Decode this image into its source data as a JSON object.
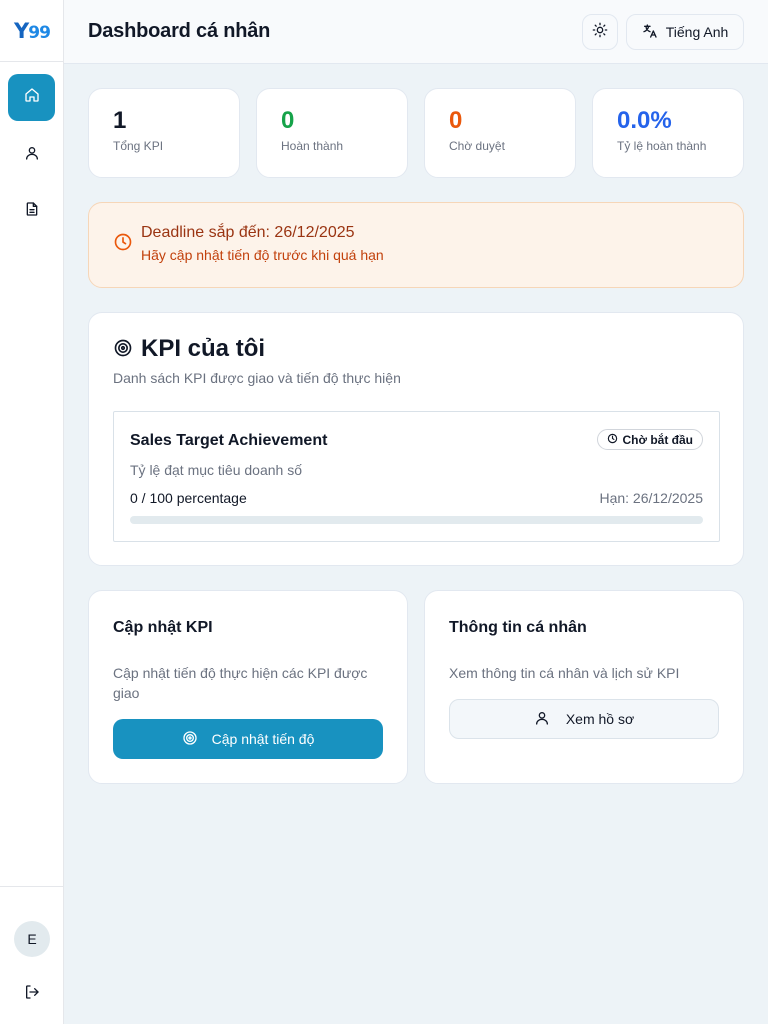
{
  "brand": {
    "logo_text": "Y99",
    "logo_letter": "Y",
    "logo_number": "99"
  },
  "colors": {
    "primary": "#1892c0",
    "green": "#16a34a",
    "orange": "#ea580c",
    "blue": "#2563eb",
    "alert_bg": "#fdf3ea"
  },
  "sidebar": {
    "items": [
      {
        "icon": "home-icon",
        "active": true
      },
      {
        "icon": "user-icon",
        "active": false
      },
      {
        "icon": "document-icon",
        "active": false
      }
    ],
    "avatar_initial": "E",
    "logout_icon": "logout-icon"
  },
  "header": {
    "title": "Dashboard cá nhân",
    "theme_icon": "sun-icon",
    "language_label": "Tiếng Anh",
    "language_icon": "translate-icon"
  },
  "stats": [
    {
      "value": "1",
      "label": "Tổng KPI",
      "color": "#111827"
    },
    {
      "value": "0",
      "label": "Hoàn thành",
      "color": "#16a34a"
    },
    {
      "value": "0",
      "label": "Chờ duyệt",
      "color": "#ea580c"
    },
    {
      "value": "0.0%",
      "label": "Tỷ lệ hoàn thành",
      "color": "#2563eb"
    }
  ],
  "alert": {
    "icon": "clock-icon",
    "title": "Deadline sắp đến: 26/12/2025",
    "subtitle": "Hãy cập nhật tiến độ trước khi quá hạn"
  },
  "kpi_section": {
    "icon": "target-icon",
    "title": "KPI của tôi",
    "description": "Danh sách KPI được giao và tiến độ thực hiện",
    "items": [
      {
        "name": "Sales Target Achievement",
        "status": "Chờ bắt đầu",
        "status_icon": "clock-icon",
        "description": "Tỷ lệ đạt mục tiêu doanh số",
        "progress_text": "0 / 100 percentage",
        "deadline": "Hạn: 26/12/2025",
        "progress_fraction": 0
      }
    ]
  },
  "actions": {
    "update": {
      "title": "Cập nhật KPI",
      "description": "Cập nhật tiến độ thực hiện các KPI được giao",
      "button_label": "Cập nhật tiến độ",
      "button_icon": "target-icon"
    },
    "profile": {
      "title": "Thông tin cá nhân",
      "description": "Xem thông tin cá nhân và lịch sử KPI",
      "button_label": "Xem hồ sơ",
      "button_icon": "user-icon"
    }
  }
}
